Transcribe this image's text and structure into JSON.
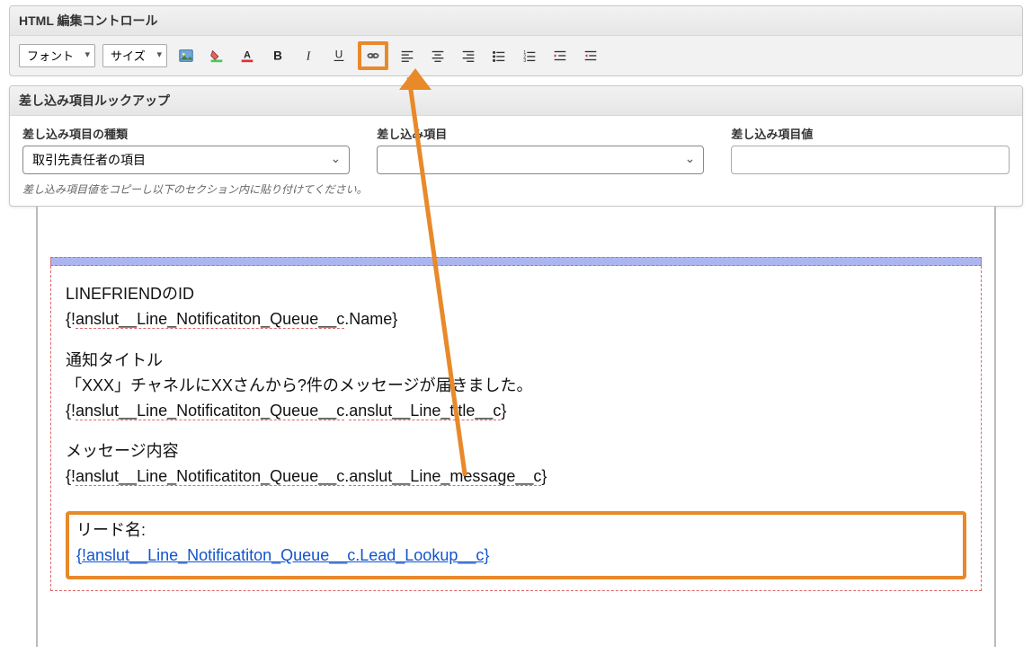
{
  "htmlControls": {
    "title": "HTML 編集コントロール",
    "fontLabel": "フォント",
    "sizeLabel": "サイズ"
  },
  "lookup": {
    "title": "差し込み項目ルックアップ",
    "col1Label": "差し込み項目の種類",
    "col1Value": "取引先責任者の項目",
    "col2Label": "差し込み項目",
    "col2Value": "",
    "col3Label": "差し込み項目値",
    "col3Value": "",
    "hint": "差し込み項目値をコピーし以下のセクション内に貼り付けてください。"
  },
  "body": {
    "line1": "LINEFRIENDのID",
    "line2a": "{!",
    "line2b": "anslut__Line_Notificatiton_Queue__c",
    "line2c": ".Name}",
    "line3": "通知タイトル",
    "line4": "「XXX」チャネルにXXさんから?件のメッセージが届きました。",
    "line5a": "{!",
    "line5b": "anslut__Line_Notificatiton_Queue__c",
    "line5c": ".",
    "line5d": "anslut__Line_title__c",
    "line5e": "}",
    "line6": "メッセージ内容",
    "line7a": "{!",
    "line7b": "anslut__Line_Notificatiton_Queue__c",
    "line7c": ".",
    "line7d": "anslut__Line_message__c",
    "line7e": "}",
    "leadLabel": "リード名:",
    "leadLink": "{!anslut__Line_Notificatiton_Queue__c.Lead_Lookup__c}"
  }
}
